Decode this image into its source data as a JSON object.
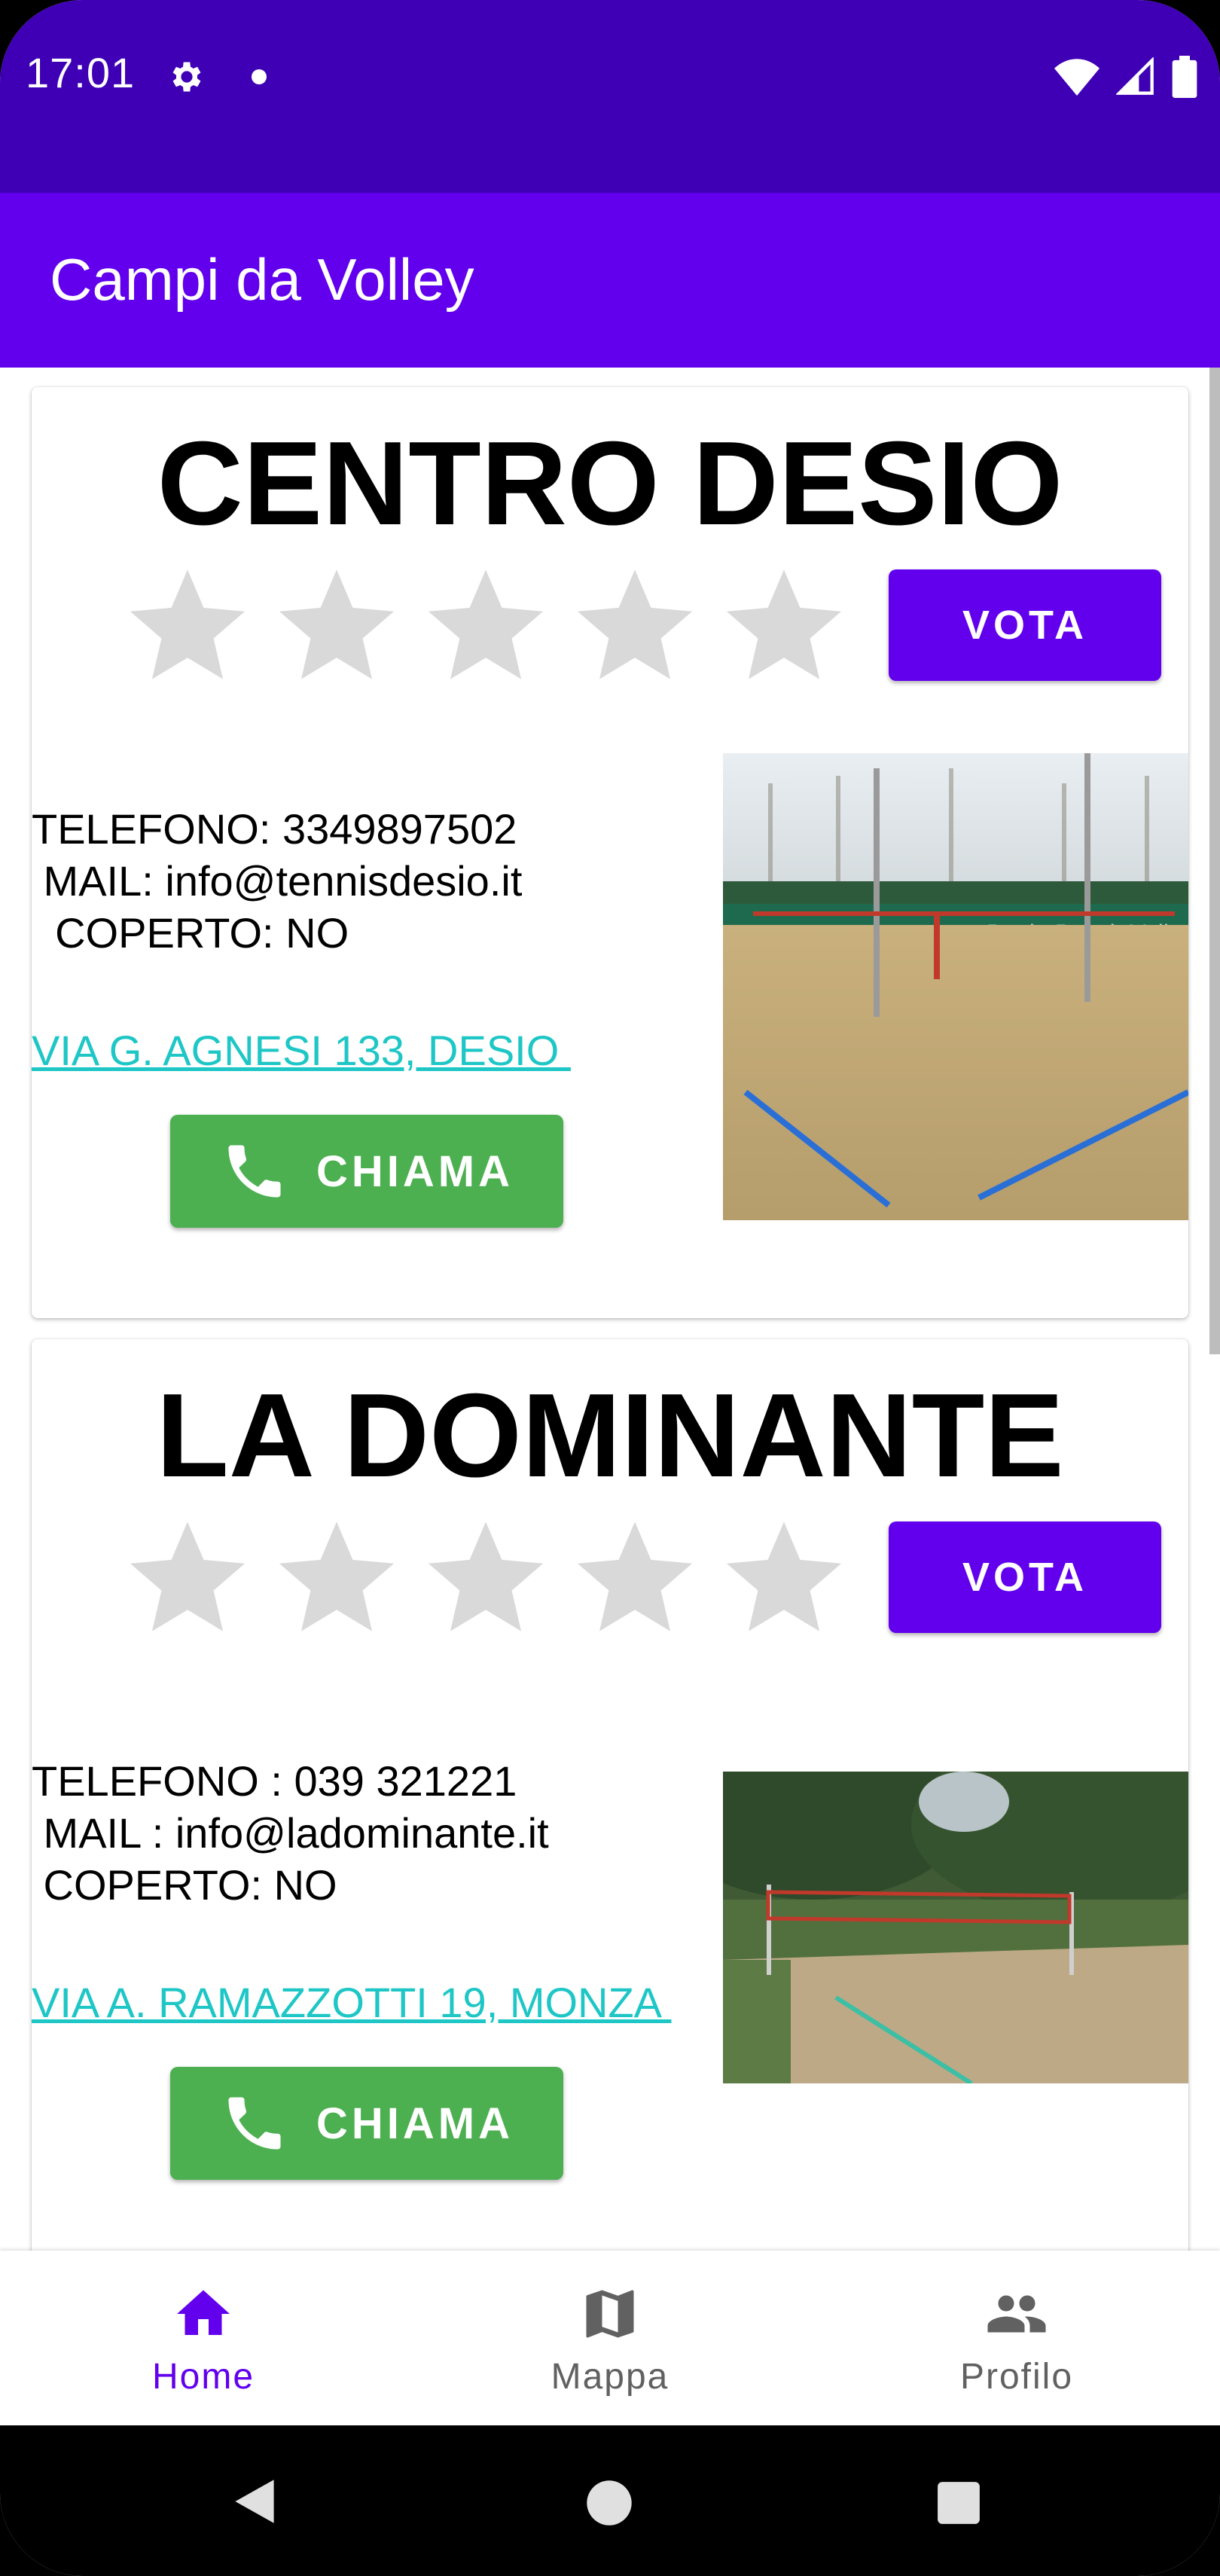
{
  "status_bar": {
    "time": "17:01",
    "icons": [
      "settings-gear-icon",
      "notification-dot-icon",
      "wifi-icon",
      "signal-icon",
      "battery-icon"
    ]
  },
  "app_bar": {
    "title": "Campi da Volley"
  },
  "cards": [
    {
      "name": "CENTRO DESIO",
      "rating": 0,
      "rating_max": 5,
      "vote_label": "VOTA",
      "phone_line": "TELEFONO: 3349897502",
      "mail_line": " MAIL: info@tennisdesio.it",
      "covered_line": "  COPERTO: NO",
      "address": "VIA G. AGNESI 133, DESIO ",
      "call_label": "CHIAMA",
      "photo_watermark": "Desio Beach Volley"
    },
    {
      "name": "LA DOMINANTE",
      "rating": 0,
      "rating_max": 5,
      "vote_label": "VOTA",
      "phone_line": "TELEFONO : 039 321221",
      "mail_line": " MAIL : info@ladominante.it",
      "covered_line": " COPERTO: NO",
      "address": "VIA A. RAMAZZOTTI 19, MONZA ",
      "call_label": "CHIAMA"
    }
  ],
  "bottom_nav": {
    "items": [
      {
        "label": "Home",
        "icon": "home-icon",
        "selected": true
      },
      {
        "label": "Mappa",
        "icon": "map-icon",
        "selected": false
      },
      {
        "label": "Profilo",
        "icon": "people-icon",
        "selected": false
      }
    ]
  },
  "colors": {
    "status_bar": "#3f00b5",
    "app_bar": "#6200ee",
    "vote_button": "#6200ee",
    "call_button": "#4caf50",
    "address_link": "#1ec6c6",
    "star_empty": "#d9d9d9",
    "nav_selected": "#6200ee",
    "nav_unselected": "#616161"
  }
}
